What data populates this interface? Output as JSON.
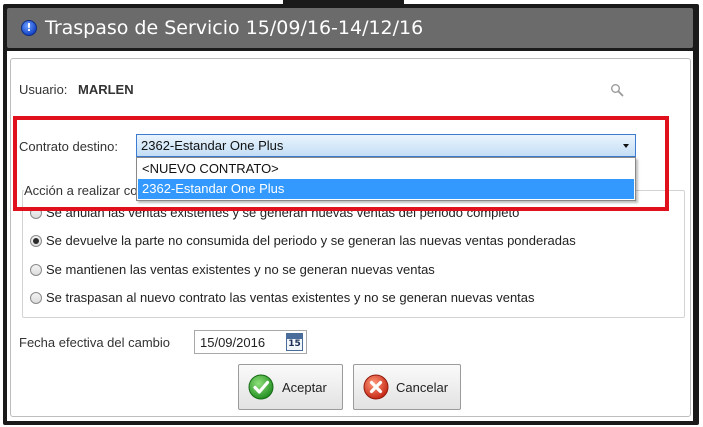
{
  "window": {
    "title": "Traspaso de Servicio 15/09/16-14/12/16",
    "icon": "info-icon"
  },
  "usuario": {
    "label": "Usuario:",
    "value": "MARLEN",
    "search_icon": "search-icon"
  },
  "contrato": {
    "label": "Contrato destino:",
    "selected": "2362-Estandar One Plus",
    "options": [
      "<NUEVO CONTRATO>",
      "2362-Estandar One Plus"
    ],
    "highlight_color": "#e0101c"
  },
  "accion": {
    "group_label": "Acción a realizar co",
    "options": [
      {
        "label": "Se anulan las ventas existentes y se generan nuevas ventas del periodo completo",
        "checked": false
      },
      {
        "label": "Se devuelve la parte no consumida del periodo y se generan las nuevas ventas ponderadas",
        "checked": true
      },
      {
        "label": "Se mantienen las ventas existentes y no se generan nuevas ventas",
        "checked": false
      },
      {
        "label": "Se traspasan al nuevo contrato las ventas existentes y no se generan nuevas ventas",
        "checked": false
      }
    ]
  },
  "fecha": {
    "label": "Fecha efectiva del cambio",
    "value": "15/09/2016",
    "calendar_day": "15"
  },
  "buttons": {
    "accept_label": "Aceptar",
    "cancel_label": "Cancelar"
  }
}
